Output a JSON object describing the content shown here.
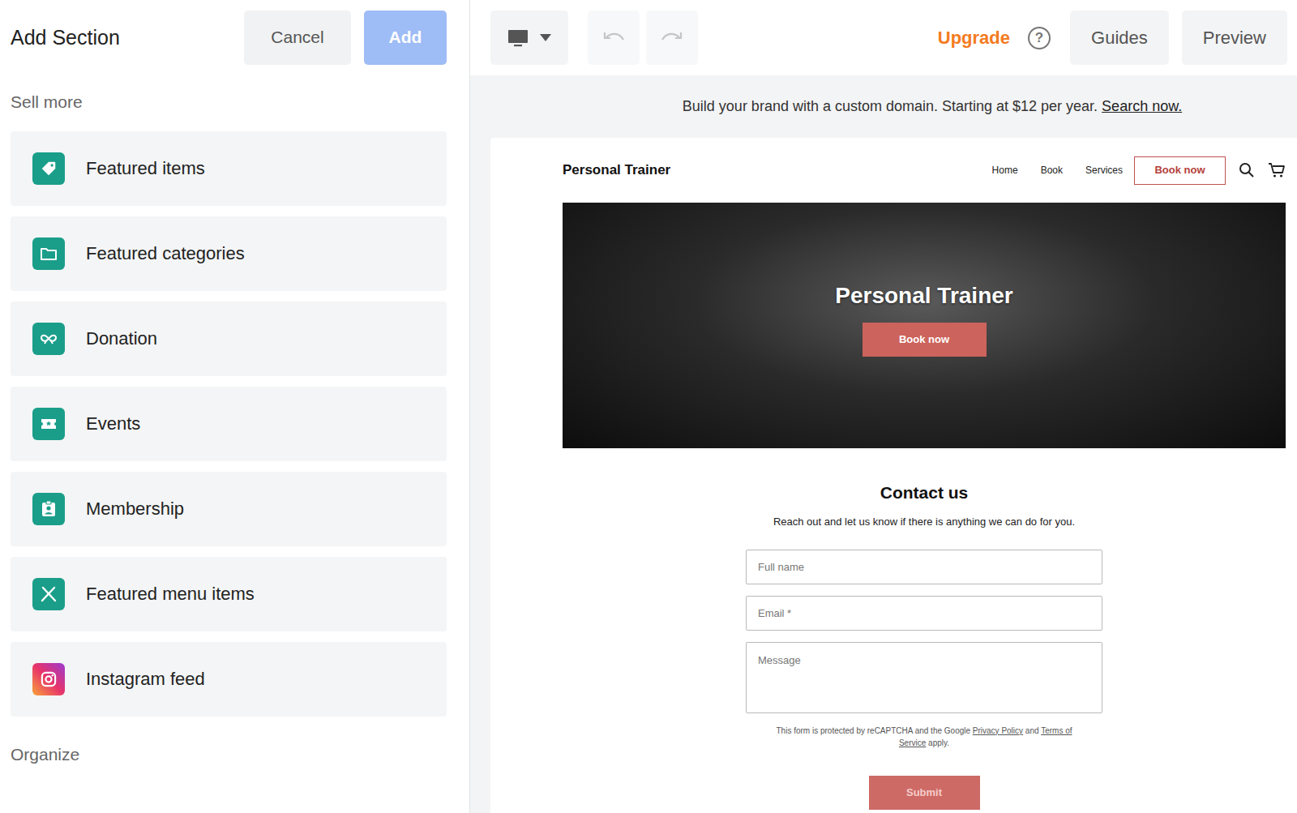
{
  "panel": {
    "title": "Add Section",
    "cancel": "Cancel",
    "add": {
      "label": "Add",
      "disabled": true
    },
    "groups": [
      {
        "label": "Sell more",
        "items": [
          {
            "label": "Featured items",
            "kind": "tag"
          },
          {
            "label": "Featured categories",
            "kind": "folder"
          },
          {
            "label": "Donation",
            "kind": "ribbon"
          },
          {
            "label": "Events",
            "kind": "ticket"
          },
          {
            "label": "Membership",
            "kind": "badge"
          },
          {
            "label": "Featured menu items",
            "kind": "utensils"
          },
          {
            "label": "Instagram feed",
            "kind": "instagram"
          }
        ]
      },
      {
        "label": "Organize",
        "items": []
      }
    ]
  },
  "toolbar": {
    "undo": {
      "disabled": true
    },
    "redo": {
      "disabled": true
    },
    "upgrade": "Upgrade",
    "help": "?",
    "guides": "Guides",
    "preview": "Preview"
  },
  "banner": {
    "text": "Build your brand with a custom domain. Starting at $12 per year.",
    "link": "Search now."
  },
  "site": {
    "brand": "Personal Trainer",
    "nav": [
      "Home",
      "Book",
      "Services"
    ],
    "cta": "Book now",
    "hero": {
      "title": "Personal Trainer",
      "button": "Book now"
    },
    "contact": {
      "title": "Contact us",
      "subtitle": "Reach out and let us know if there is anything we can do for you.",
      "fields": [
        {
          "placeholder": "Full name",
          "kind": "input"
        },
        {
          "placeholder": "Email *",
          "kind": "input"
        },
        {
          "placeholder": "Message",
          "kind": "textarea"
        }
      ],
      "recaptcha": {
        "before": "This form is protected by reCAPTCHA and the Google",
        "privacy": "Privacy Policy",
        "and": "and",
        "terms": "Terms of Service",
        "after": "apply."
      },
      "submit": "Submit"
    }
  }
}
